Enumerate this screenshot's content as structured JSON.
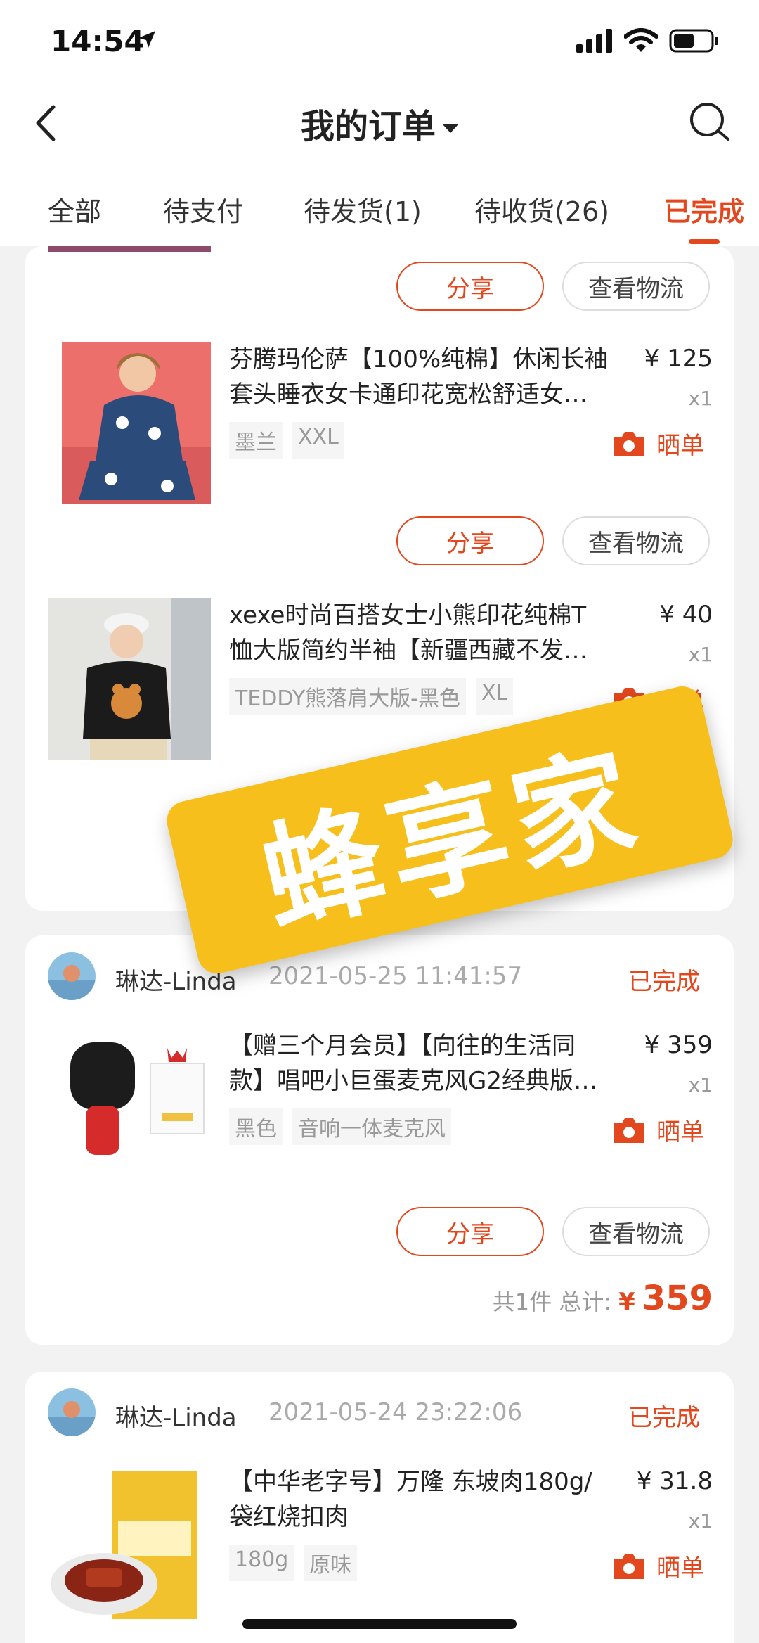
{
  "status_bar": {
    "time": "14:54"
  },
  "nav": {
    "title": "我的订单"
  },
  "tabs": [
    {
      "label": "全部"
    },
    {
      "label": "待支付"
    },
    {
      "label": "待发货(1)"
    },
    {
      "label": "待收货(26)"
    },
    {
      "label": "已完成"
    }
  ],
  "common": {
    "share": "分享",
    "logistics": "查看物流",
    "shaidan": "晒单",
    "qty": "x1",
    "total_label": "共1件 总计:",
    "currency": "¥"
  },
  "order1": {
    "items": [
      {
        "title": "芬腾玛伦萨【100%纯棉】休闲长袖套头睡衣女卡通印花宽松舒适女…",
        "price": "¥ 125",
        "tags": [
          "墨兰",
          "XXL"
        ]
      },
      {
        "title": "xexe时尚百搭女士小熊印花纯棉T恤大版简约半袖【新疆西藏不发…",
        "price": "¥ 40",
        "tags": [
          "TEDDY熊落肩大版-黑色",
          "XL"
        ]
      }
    ]
  },
  "order2": {
    "seller": "琳达-Linda",
    "date": "2021-05-25 11:41:57",
    "status": "已完成",
    "title": "【赠三个月会员】【向往的生活同款】唱吧小巨蛋麦克风G2经典版…",
    "price": "¥ 359",
    "tags": [
      "黑色",
      "音响一体麦克风"
    ],
    "total": "359"
  },
  "order3": {
    "seller": "琳达-Linda",
    "date": "2021-05-24 23:22:06",
    "status": "已完成",
    "title": "【中华老字号】万隆 东坡肉180g/袋红烧扣肉",
    "price": "¥ 31.8",
    "tags": [
      "180g",
      "原味"
    ]
  },
  "watermark": "蜂享家",
  "colors": {
    "accent": "#e2471d",
    "watermark_bg": "#f7bf1c"
  }
}
